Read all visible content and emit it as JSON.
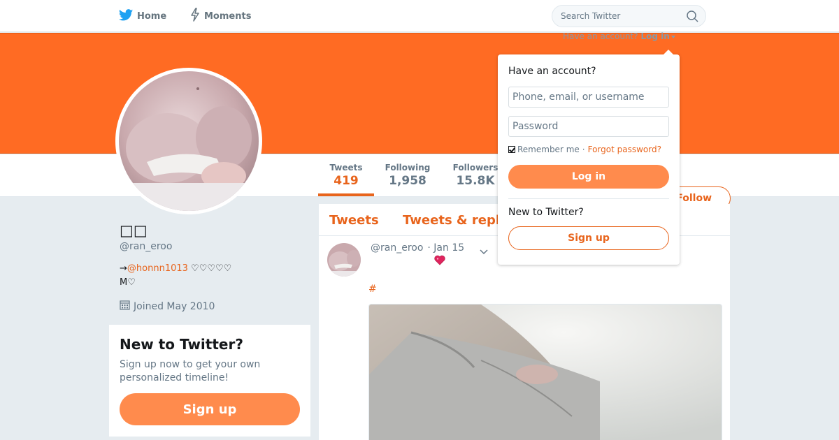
{
  "nav": {
    "home_label": "Home",
    "moments_label": "Moments",
    "search_placeholder": "Search Twitter",
    "account_prompt": "Have an account?",
    "login_link": "Log in"
  },
  "colors": {
    "accent": "#e8641c",
    "banner": "#ff6b23",
    "button_fill": "#ff8b4d"
  },
  "icons": {
    "home": "twitter-bird-icon",
    "moments": "lightning-icon",
    "search": "search-icon",
    "joined": "calendar-icon",
    "tweet_menu": "chevron-down-icon",
    "heart": "heart-icon"
  },
  "profile_nav": {
    "tweets_label": "Tweets",
    "tweets_count": "419",
    "following_label": "Following",
    "following_count": "1,958",
    "followers_label": "Followers",
    "followers_count": "15.8K",
    "follow_button": "Follow"
  },
  "profile": {
    "name": "□□",
    "handle": "@ran_eroo",
    "bio_arrow": "→",
    "bio_mention": "@honnn1013",
    "bio_hearts": " ♡♡♡♡♡",
    "bio_line2": "M♡",
    "joined": "Joined May 2010"
  },
  "signup_card": {
    "title": "New to Twitter?",
    "description": "Sign up now to get your own personalized timeline!",
    "button": "Sign up"
  },
  "timeline": {
    "tab_tweets": "Tweets",
    "tab_replies": "Tweets & repl",
    "tweet": {
      "handle": "@ran_eroo",
      "date": "· Jan 15",
      "hashtag": "#"
    }
  },
  "login_dropdown": {
    "heading": "Have an account?",
    "username_placeholder": "Phone, email, or username",
    "password_placeholder": "Password",
    "remember_label": "Remember me",
    "forgot_link": "Forgot password?",
    "login_button": "Log in",
    "new_heading": "New to Twitter?",
    "signup_button": "Sign up"
  }
}
